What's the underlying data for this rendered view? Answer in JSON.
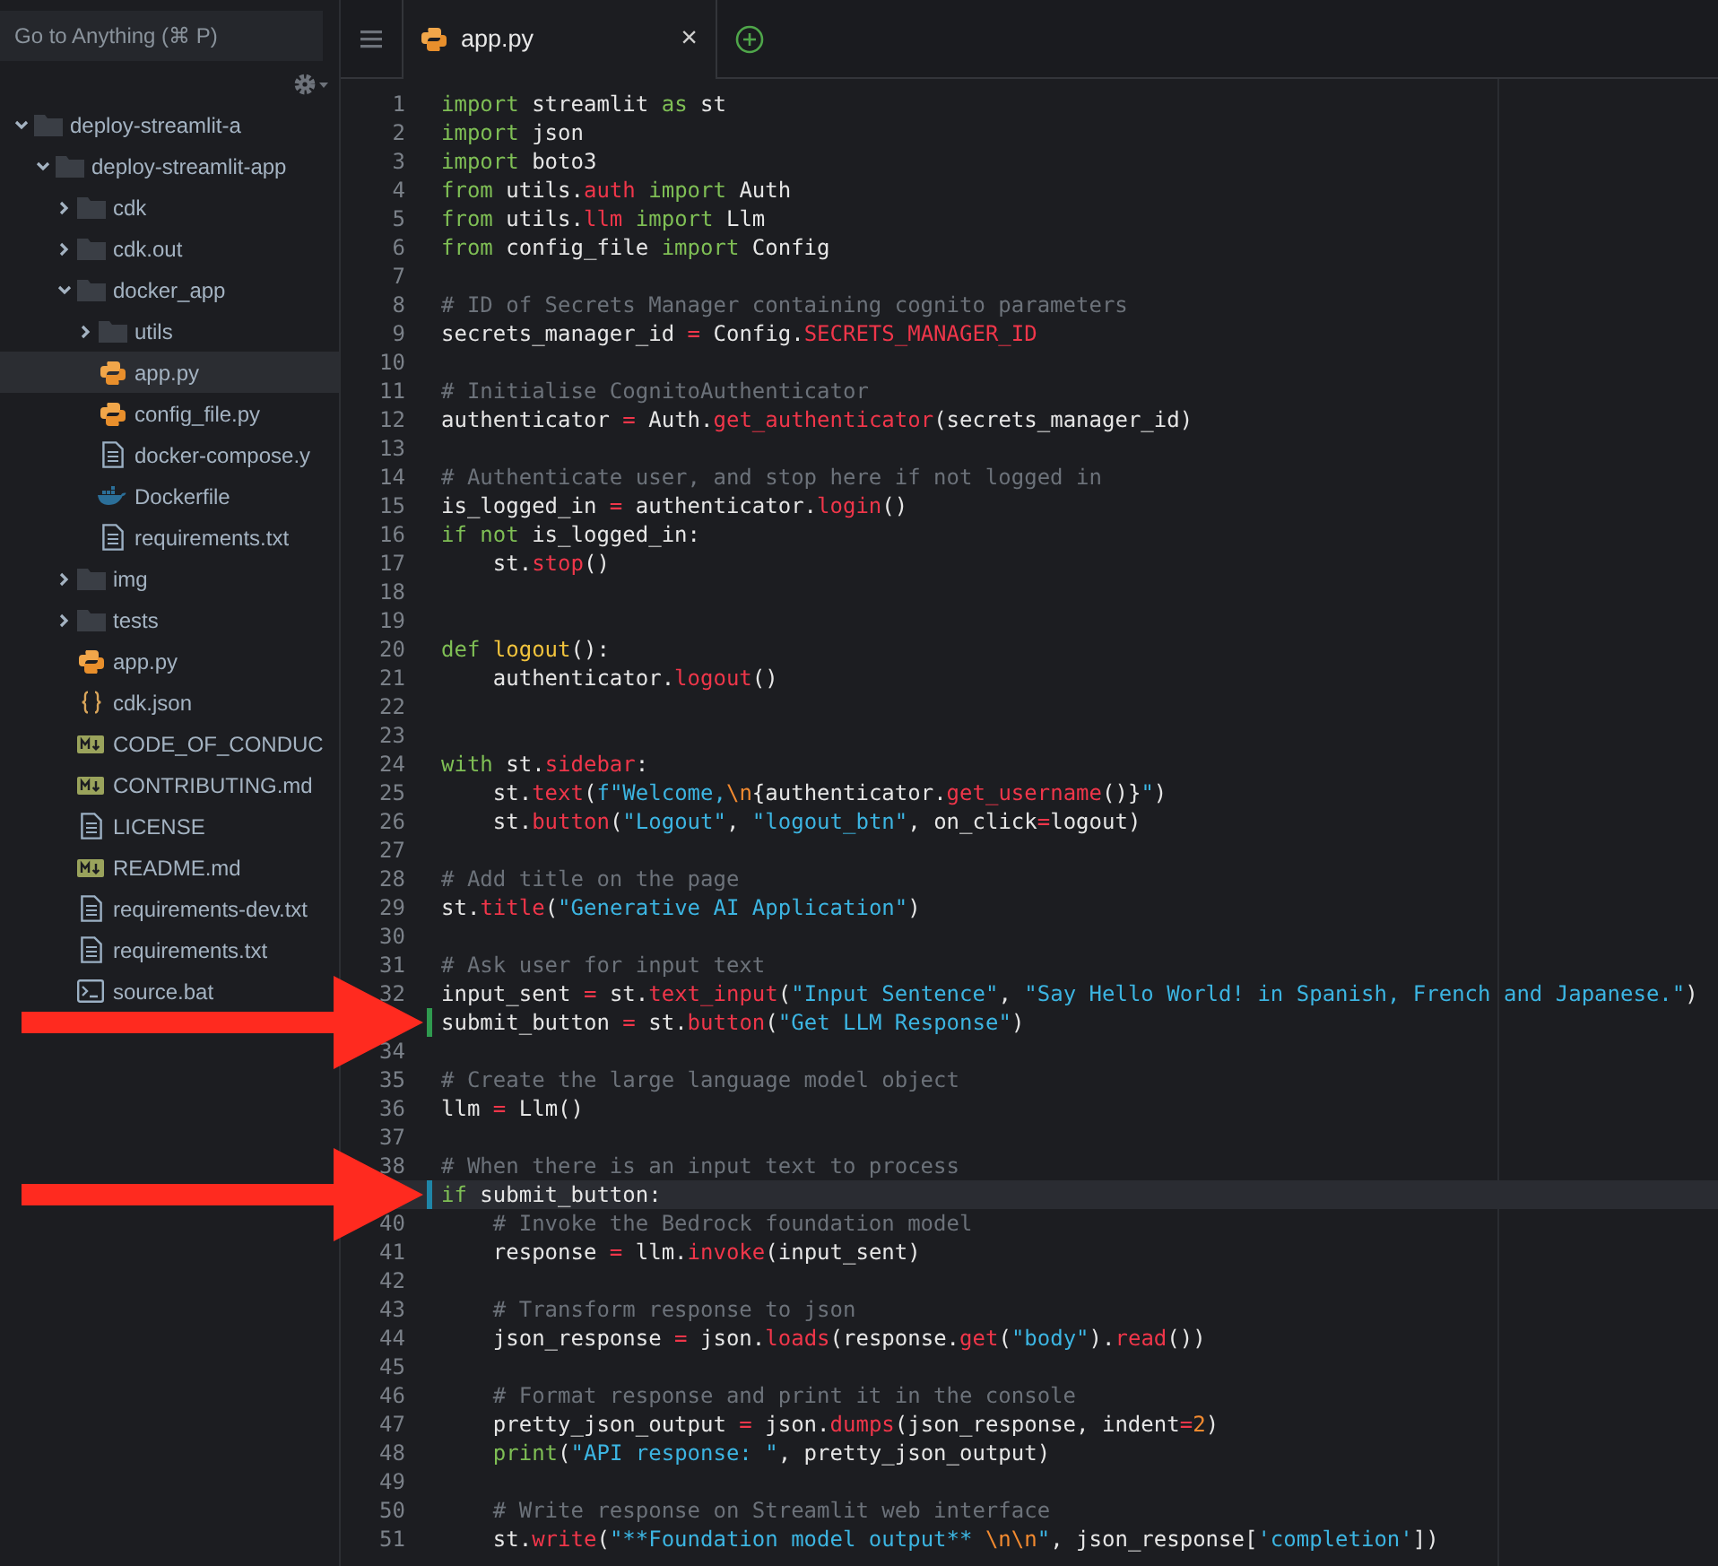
{
  "search": {
    "placeholder": "Go to Anything (⌘ P)"
  },
  "tree": [
    {
      "name": "deploy-streamlit-a",
      "kind": "folder",
      "expanded": true,
      "selected": false,
      "children": [
        {
          "name": "deploy-streamlit-app",
          "kind": "folder",
          "expanded": true,
          "selected": false,
          "children": [
            {
              "name": "cdk",
              "kind": "folder",
              "expanded": false,
              "selected": false
            },
            {
              "name": "cdk.out",
              "kind": "folder",
              "expanded": false,
              "selected": false
            },
            {
              "name": "docker_app",
              "kind": "folder",
              "expanded": true,
              "selected": false,
              "children": [
                {
                  "name": "utils",
                  "kind": "folder",
                  "expanded": false,
                  "selected": false
                },
                {
                  "name": "app.py",
                  "kind": "python",
                  "selected": true
                },
                {
                  "name": "config_file.py",
                  "kind": "python",
                  "selected": false
                },
                {
                  "name": "docker-compose.y",
                  "kind": "text",
                  "selected": false
                },
                {
                  "name": "Dockerfile",
                  "kind": "docker",
                  "selected": false
                },
                {
                  "name": "requirements.txt",
                  "kind": "text",
                  "selected": false
                }
              ]
            },
            {
              "name": "img",
              "kind": "folder",
              "expanded": false,
              "selected": false
            },
            {
              "name": "tests",
              "kind": "folder",
              "expanded": false,
              "selected": false
            },
            {
              "name": "app.py",
              "kind": "python",
              "selected": false
            },
            {
              "name": "cdk.json",
              "kind": "json",
              "selected": false
            },
            {
              "name": "CODE_OF_CONDUC",
              "kind": "markdown",
              "selected": false
            },
            {
              "name": "CONTRIBUTING.md",
              "kind": "markdown",
              "selected": false
            },
            {
              "name": "LICENSE",
              "kind": "text",
              "selected": false
            },
            {
              "name": "README.md",
              "kind": "markdown",
              "selected": false
            },
            {
              "name": "requirements-dev.txt",
              "kind": "text",
              "selected": false
            },
            {
              "name": "requirements.txt",
              "kind": "text",
              "selected": false
            },
            {
              "name": "source.bat",
              "kind": "shell",
              "selected": false
            }
          ]
        }
      ]
    }
  ],
  "tabs": [
    {
      "label": "app.py",
      "kind": "python",
      "close": "×",
      "selected": true
    }
  ],
  "code": [
    {
      "number": "1",
      "tokens": [
        {
          "kind": "keyword",
          "text": "import"
        },
        {
          "kind": "plain",
          "text": " streamlit "
        },
        {
          "kind": "keyword",
          "text": "as"
        },
        {
          "kind": "plain",
          "text": " st"
        }
      ]
    },
    {
      "number": "2",
      "tokens": [
        {
          "kind": "keyword",
          "text": "import"
        },
        {
          "kind": "plain",
          "text": " json"
        }
      ]
    },
    {
      "number": "3",
      "tokens": [
        {
          "kind": "keyword",
          "text": "import"
        },
        {
          "kind": "plain",
          "text": " boto3"
        }
      ]
    },
    {
      "number": "4",
      "tokens": [
        {
          "kind": "keyword",
          "text": "from"
        },
        {
          "kind": "plain",
          "text": " utils."
        },
        {
          "kind": "call",
          "text": "auth"
        },
        {
          "kind": "keyword",
          "text": " import"
        },
        {
          "kind": "plain",
          "text": " Auth"
        }
      ]
    },
    {
      "number": "5",
      "tokens": [
        {
          "kind": "keyword",
          "text": "from"
        },
        {
          "kind": "plain",
          "text": " utils."
        },
        {
          "kind": "call",
          "text": "llm"
        },
        {
          "kind": "keyword",
          "text": " import"
        },
        {
          "kind": "plain",
          "text": " Llm"
        }
      ]
    },
    {
      "number": "6",
      "tokens": [
        {
          "kind": "keyword",
          "text": "from"
        },
        {
          "kind": "plain",
          "text": " config_file "
        },
        {
          "kind": "keyword",
          "text": "import"
        },
        {
          "kind": "plain",
          "text": " Config"
        }
      ]
    },
    {
      "number": "7"
    },
    {
      "number": "8",
      "tokens": [
        {
          "kind": "comment",
          "text": "# ID of Secrets Manager containing cognito parameters"
        }
      ]
    },
    {
      "number": "9",
      "tokens": [
        {
          "kind": "plain",
          "text": "secrets_manager_id "
        },
        {
          "kind": "operator",
          "text": "="
        },
        {
          "kind": "plain",
          "text": " Config."
        },
        {
          "kind": "call",
          "text": "SECRETS_MANAGER_ID"
        }
      ]
    },
    {
      "number": "10"
    },
    {
      "number": "11",
      "tokens": [
        {
          "kind": "comment",
          "text": "# Initialise CognitoAuthenticator"
        }
      ]
    },
    {
      "number": "12",
      "tokens": [
        {
          "kind": "plain",
          "text": "authenticator "
        },
        {
          "kind": "operator",
          "text": "="
        },
        {
          "kind": "plain",
          "text": " Auth."
        },
        {
          "kind": "call",
          "text": "get_authenticator"
        },
        {
          "kind": "plain",
          "text": "(secrets_manager_id)"
        }
      ]
    },
    {
      "number": "13"
    },
    {
      "number": "14",
      "tokens": [
        {
          "kind": "comment",
          "text": "# Authenticate user, and stop here if not logged in"
        }
      ]
    },
    {
      "number": "15",
      "tokens": [
        {
          "kind": "plain",
          "text": "is_logged_in "
        },
        {
          "kind": "operator",
          "text": "="
        },
        {
          "kind": "plain",
          "text": " authenticator."
        },
        {
          "kind": "call",
          "text": "login"
        },
        {
          "kind": "plain",
          "text": "()"
        }
      ]
    },
    {
      "number": "16",
      "tokens": [
        {
          "kind": "keyword",
          "text": "if"
        },
        {
          "kind": "keyword",
          "text": " not"
        },
        {
          "kind": "plain",
          "text": " is_logged_in:"
        }
      ]
    },
    {
      "number": "17",
      "tokens": [
        {
          "kind": "plain",
          "text": "    st."
        },
        {
          "kind": "call",
          "text": "stop"
        },
        {
          "kind": "plain",
          "text": "()"
        }
      ]
    },
    {
      "number": "18"
    },
    {
      "number": "19"
    },
    {
      "number": "20",
      "tokens": [
        {
          "kind": "keyword",
          "text": "def"
        },
        {
          "kind": "defname",
          "text": " logout"
        },
        {
          "kind": "plain",
          "text": "():"
        }
      ]
    },
    {
      "number": "21",
      "tokens": [
        {
          "kind": "plain",
          "text": "    authenticator."
        },
        {
          "kind": "call",
          "text": "logout"
        },
        {
          "kind": "plain",
          "text": "()"
        }
      ]
    },
    {
      "number": "22"
    },
    {
      "number": "23"
    },
    {
      "number": "24",
      "tokens": [
        {
          "kind": "keyword",
          "text": "with"
        },
        {
          "kind": "plain",
          "text": " st."
        },
        {
          "kind": "call",
          "text": "sidebar"
        },
        {
          "kind": "plain",
          "text": ":"
        }
      ]
    },
    {
      "number": "25",
      "tokens": [
        {
          "kind": "plain",
          "text": "    st."
        },
        {
          "kind": "call",
          "text": "text"
        },
        {
          "kind": "plain",
          "text": "("
        },
        {
          "kind": "string",
          "text": "f\"Welcome,"
        },
        {
          "kind": "escape",
          "text": "\\n"
        },
        {
          "kind": "plain",
          "text": "{authenticator."
        },
        {
          "kind": "call",
          "text": "get_username"
        },
        {
          "kind": "plain",
          "text": "()}"
        },
        {
          "kind": "string",
          "text": "\""
        },
        {
          "kind": "plain",
          "text": ")"
        }
      ]
    },
    {
      "number": "26",
      "tokens": [
        {
          "kind": "plain",
          "text": "    st."
        },
        {
          "kind": "call",
          "text": "button"
        },
        {
          "kind": "plain",
          "text": "("
        },
        {
          "kind": "string",
          "text": "\"Logout\""
        },
        {
          "kind": "plain",
          "text": ", "
        },
        {
          "kind": "string",
          "text": "\"logout_btn\""
        },
        {
          "kind": "plain",
          "text": ", on_click"
        },
        {
          "kind": "operator",
          "text": "="
        },
        {
          "kind": "plain",
          "text": "logout)"
        }
      ]
    },
    {
      "number": "27"
    },
    {
      "number": "28",
      "tokens": [
        {
          "kind": "comment",
          "text": "# Add title on the page"
        }
      ]
    },
    {
      "number": "29",
      "tokens": [
        {
          "kind": "plain",
          "text": "st."
        },
        {
          "kind": "call",
          "text": "title"
        },
        {
          "kind": "plain",
          "text": "("
        },
        {
          "kind": "string",
          "text": "\"Generative AI Application\""
        },
        {
          "kind": "plain",
          "text": ")"
        }
      ]
    },
    {
      "number": "30"
    },
    {
      "number": "31",
      "tokens": [
        {
          "kind": "comment",
          "text": "# Ask user for input text"
        }
      ]
    },
    {
      "number": "32",
      "tokens": [
        {
          "kind": "plain",
          "text": "input_sent "
        },
        {
          "kind": "operator",
          "text": "="
        },
        {
          "kind": "plain",
          "text": " st."
        },
        {
          "kind": "call",
          "text": "text_input"
        },
        {
          "kind": "plain",
          "text": "("
        },
        {
          "kind": "string",
          "text": "\"Input Sentence\""
        },
        {
          "kind": "plain",
          "text": ", "
        },
        {
          "kind": "string",
          "text": "\"Say Hello World! in Spanish, French and Japanese.\""
        },
        {
          "kind": "plain",
          "text": ")"
        }
      ]
    },
    {
      "arrow": true,
      "color": "#2f9a4f",
      "current": false,
      "tokens": [
        {
          "kind": "plain",
          "text": "submit_button "
        },
        {
          "kind": "operator",
          "text": "="
        },
        {
          "kind": "plain",
          "text": " st."
        },
        {
          "kind": "call",
          "text": "button"
        },
        {
          "kind": "plain",
          "text": "("
        },
        {
          "kind": "string",
          "text": "\"Get LLM Response\""
        },
        {
          "kind": "plain",
          "text": ")"
        }
      ]
    },
    {
      "number": "34"
    },
    {
      "number": "35",
      "tokens": [
        {
          "kind": "comment",
          "text": "# Create the large language model object"
        }
      ]
    },
    {
      "number": "36",
      "tokens": [
        {
          "kind": "plain",
          "text": "llm "
        },
        {
          "kind": "operator",
          "text": "="
        },
        {
          "kind": "plain",
          "text": " Llm()"
        }
      ]
    },
    {
      "number": "37"
    },
    {
      "number": "38",
      "tokens": [
        {
          "kind": "comment",
          "text": "# When there is an input text to process"
        }
      ]
    },
    {
      "arrow": true,
      "color": "#1f86a8",
      "current": true,
      "tokens": [
        {
          "kind": "keyword",
          "text": "if"
        },
        {
          "kind": "plain",
          "text": " submit_button:"
        }
      ]
    },
    {
      "number": "40",
      "tokens": [
        {
          "kind": "comment",
          "text": "    # Invoke the Bedrock foundation model"
        }
      ]
    },
    {
      "number": "41",
      "tokens": [
        {
          "kind": "plain",
          "text": "    response "
        },
        {
          "kind": "operator",
          "text": "="
        },
        {
          "kind": "plain",
          "text": " llm."
        },
        {
          "kind": "call",
          "text": "invoke"
        },
        {
          "kind": "plain",
          "text": "(input_sent)"
        }
      ]
    },
    {
      "number": "42"
    },
    {
      "number": "43",
      "tokens": [
        {
          "kind": "comment",
          "text": "    # Transform response to json"
        }
      ]
    },
    {
      "number": "44",
      "tokens": [
        {
          "kind": "plain",
          "text": "    json_response "
        },
        {
          "kind": "operator",
          "text": "="
        },
        {
          "kind": "plain",
          "text": " json."
        },
        {
          "kind": "call",
          "text": "loads"
        },
        {
          "kind": "plain",
          "text": "(response."
        },
        {
          "kind": "call",
          "text": "get"
        },
        {
          "kind": "plain",
          "text": "("
        },
        {
          "kind": "string",
          "text": "\"body\""
        },
        {
          "kind": "plain",
          "text": ")."
        },
        {
          "kind": "call",
          "text": "read"
        },
        {
          "kind": "plain",
          "text": "())"
        }
      ]
    },
    {
      "number": "45"
    },
    {
      "number": "46",
      "tokens": [
        {
          "kind": "comment",
          "text": "    # Format response and print it in the console"
        }
      ]
    },
    {
      "number": "47",
      "tokens": [
        {
          "kind": "plain",
          "text": "    pretty_json_output "
        },
        {
          "kind": "operator",
          "text": "="
        },
        {
          "kind": "plain",
          "text": " json."
        },
        {
          "kind": "call",
          "text": "dumps"
        },
        {
          "kind": "plain",
          "text": "(json_response, indent"
        },
        {
          "kind": "operator",
          "text": "="
        },
        {
          "kind": "escape",
          "text": "2"
        },
        {
          "kind": "plain",
          "text": ")"
        }
      ]
    },
    {
      "number": "48",
      "tokens": [
        {
          "kind": "keyword",
          "text": "    print"
        },
        {
          "kind": "plain",
          "text": "("
        },
        {
          "kind": "string",
          "text": "\"API response: \""
        },
        {
          "kind": "plain",
          "text": ", pretty_json_output)"
        }
      ]
    },
    {
      "number": "49"
    },
    {
      "number": "50",
      "tokens": [
        {
          "kind": "comment",
          "text": "    # Write response on Streamlit web interface"
        }
      ]
    },
    {
      "number": "51",
      "tokens": [
        {
          "kind": "plain",
          "text": "    st."
        },
        {
          "kind": "call",
          "text": "write"
        },
        {
          "kind": "plain",
          "text": "("
        },
        {
          "kind": "string",
          "text": "\"**Foundation model output** "
        },
        {
          "kind": "escape",
          "text": "\\n\\n"
        },
        {
          "kind": "string",
          "text": "\""
        },
        {
          "kind": "plain",
          "text": ", json_response["
        },
        {
          "kind": "string",
          "text": "'completion'"
        },
        {
          "kind": "plain",
          "text": "])"
        }
      ]
    }
  ]
}
